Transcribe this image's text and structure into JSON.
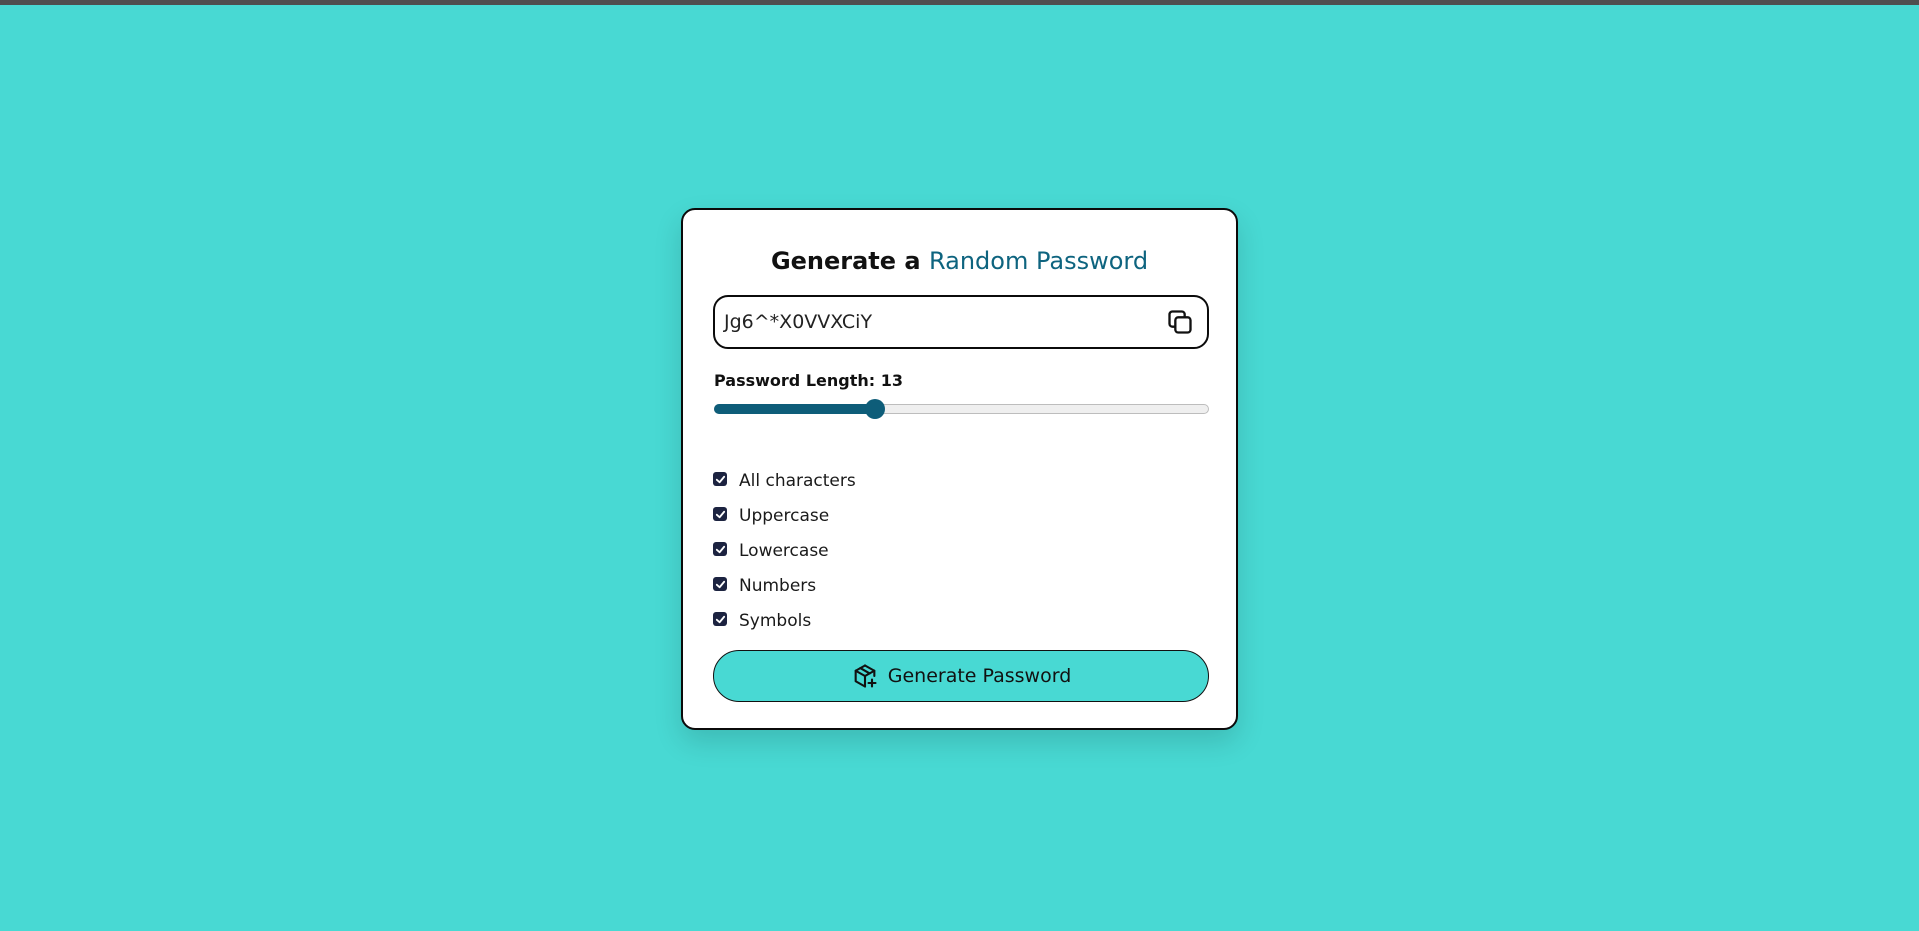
{
  "header": {
    "title_prefix": "Generate a",
    "title_accent": "Random Password"
  },
  "password": {
    "value": "Jg6^*X0VVXCiY",
    "copy_icon": "copy-icon"
  },
  "length": {
    "label": "Password Length:",
    "value": "13",
    "slider_fraction": 0.326
  },
  "options": [
    {
      "label": "All characters",
      "checked": true
    },
    {
      "label": "Uppercase",
      "checked": true
    },
    {
      "label": "Lowercase",
      "checked": true
    },
    {
      "label": "Numbers",
      "checked": true
    },
    {
      "label": "Symbols",
      "checked": true
    }
  ],
  "generate_button": {
    "label": "Generate Password",
    "icon": "package-plus-icon"
  },
  "colors": {
    "background": "#48d9d3",
    "accent": "#0e647f",
    "slider": "#0e5d79"
  }
}
